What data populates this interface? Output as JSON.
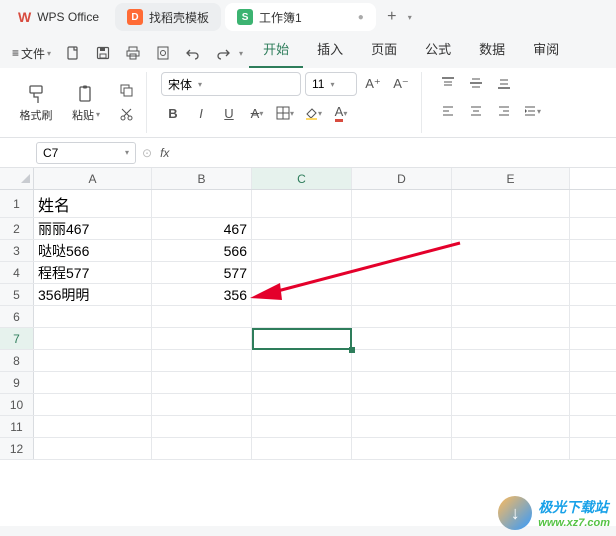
{
  "app_tabs": {
    "home_label": "WPS Office",
    "tab1_label": "找稻壳模板",
    "tab2_prefix": "S",
    "tab2_label": "工作簿1"
  },
  "quickbar": {
    "file_label": "文件"
  },
  "menu": {
    "items": [
      "开始",
      "插入",
      "页面",
      "公式",
      "数据",
      "审阅"
    ],
    "active_index": 0
  },
  "ribbon": {
    "fmt_painter": "格式刷",
    "paste": "粘贴",
    "font_name": "宋体",
    "font_size": "11",
    "bold": "B",
    "italic": "I",
    "underline": "U",
    "a_inc": "A⁺",
    "a_dec": "A⁻"
  },
  "namebox": {
    "ref": "C7",
    "fx": "fx"
  },
  "columns": [
    "A",
    "B",
    "C",
    "D",
    "E"
  ],
  "row_numbers": [
    "1",
    "2",
    "3",
    "4",
    "5",
    "6",
    "7",
    "8",
    "9",
    "10",
    "11",
    "12"
  ],
  "cells": {
    "A1": "姓名",
    "A2": "丽丽467",
    "B2": "467",
    "A3": "哒哒566",
    "B3": "566",
    "A4": "程程577",
    "B4": "577",
    "A5": "356明明",
    "B5": "356"
  },
  "chart_data": {
    "type": "table",
    "columns": [
      "姓名",
      "value"
    ],
    "rows": [
      {
        "姓名": "丽丽467",
        "value": 467
      },
      {
        "姓名": "哒哒566",
        "value": 566
      },
      {
        "姓名": "程程577",
        "value": 577
      },
      {
        "姓名": "356明明",
        "value": 356
      }
    ]
  },
  "watermark": {
    "icon": "↓",
    "line1": "极光下载站",
    "line2": "www.xz7.com"
  }
}
